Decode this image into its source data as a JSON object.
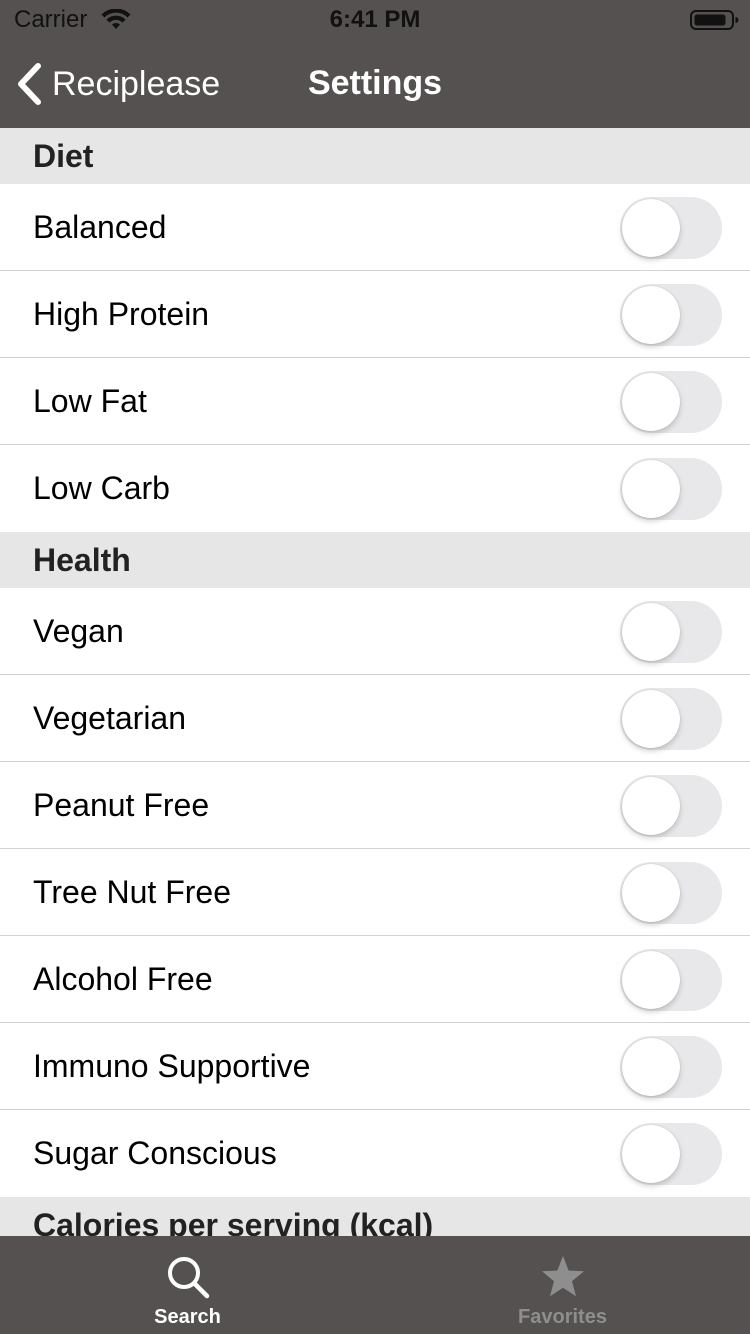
{
  "status_bar": {
    "carrier": "Carrier",
    "time": "6:41 PM"
  },
  "nav": {
    "back_label": "Reciplease",
    "title": "Settings"
  },
  "sections": [
    {
      "header": "Diet",
      "items": [
        {
          "label": "Balanced",
          "on": false
        },
        {
          "label": "High Protein",
          "on": false
        },
        {
          "label": "Low Fat",
          "on": false
        },
        {
          "label": "Low Carb",
          "on": false
        }
      ]
    },
    {
      "header": "Health",
      "items": [
        {
          "label": "Vegan",
          "on": false
        },
        {
          "label": "Vegetarian",
          "on": false
        },
        {
          "label": "Peanut Free",
          "on": false
        },
        {
          "label": "Tree Nut Free",
          "on": false
        },
        {
          "label": "Alcohol Free",
          "on": false
        },
        {
          "label": "Immuno Supportive",
          "on": false
        },
        {
          "label": "Sugar Conscious",
          "on": false
        }
      ]
    },
    {
      "header": "Calories per serving (kcal)",
      "items": []
    }
  ],
  "tab_bar": {
    "search_label": "Search",
    "favorites_label": "Favorites",
    "selected": "search"
  },
  "colors": {
    "bar_background": "#555150",
    "section_background": "#e6e6e6",
    "tab_active": "#ffffff",
    "tab_inactive": "#8e8e8e"
  }
}
